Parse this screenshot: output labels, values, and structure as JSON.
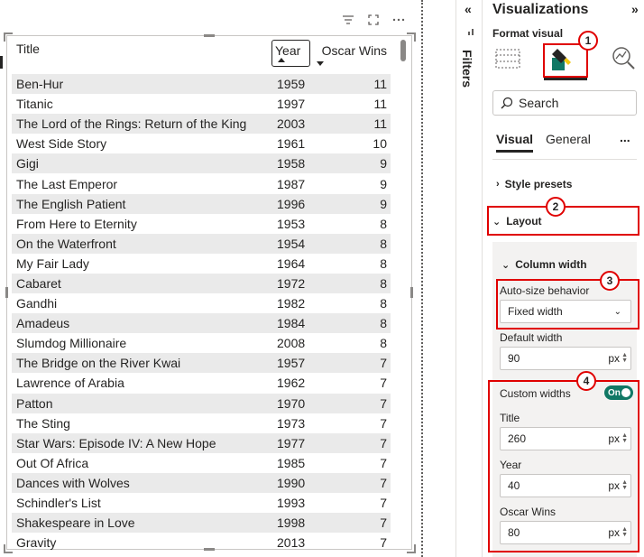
{
  "table": {
    "headers": {
      "title": "Title",
      "year": "Year",
      "wins": "Oscar Wins"
    },
    "rows": [
      {
        "title": "Ben-Hur",
        "year": "1959",
        "wins": "11"
      },
      {
        "title": "Titanic",
        "year": "1997",
        "wins": "11"
      },
      {
        "title": "The Lord of the Rings: Return of the King",
        "year": "2003",
        "wins": "11"
      },
      {
        "title": "West Side Story",
        "year": "1961",
        "wins": "10"
      },
      {
        "title": "Gigi",
        "year": "1958",
        "wins": "9"
      },
      {
        "title": "The Last Emperor",
        "year": "1987",
        "wins": "9"
      },
      {
        "title": "The English Patient",
        "year": "1996",
        "wins": "9"
      },
      {
        "title": "From Here to Eternity",
        "year": "1953",
        "wins": "8"
      },
      {
        "title": "On the Waterfront",
        "year": "1954",
        "wins": "8"
      },
      {
        "title": "My Fair Lady",
        "year": "1964",
        "wins": "8"
      },
      {
        "title": "Cabaret",
        "year": "1972",
        "wins": "8"
      },
      {
        "title": "Gandhi",
        "year": "1982",
        "wins": "8"
      },
      {
        "title": "Amadeus",
        "year": "1984",
        "wins": "8"
      },
      {
        "title": "Slumdog Millionaire",
        "year": "2008",
        "wins": "8"
      },
      {
        "title": "The Bridge on the River Kwai",
        "year": "1957",
        "wins": "7"
      },
      {
        "title": "Lawrence of Arabia",
        "year": "1962",
        "wins": "7"
      },
      {
        "title": "Patton",
        "year": "1970",
        "wins": "7"
      },
      {
        "title": "The Sting",
        "year": "1973",
        "wins": "7"
      },
      {
        "title": "Star Wars: Episode IV: A New Hope",
        "year": "1977",
        "wins": "7"
      },
      {
        "title": "Out Of Africa",
        "year": "1985",
        "wins": "7"
      },
      {
        "title": "Dances with Wolves",
        "year": "1990",
        "wins": "7"
      },
      {
        "title": "Schindler's List",
        "year": "1993",
        "wins": "7"
      },
      {
        "title": "Shakespeare in Love",
        "year": "1998",
        "wins": "7"
      },
      {
        "title": "Gravity",
        "year": "2013",
        "wins": "7"
      }
    ]
  },
  "filters": {
    "label": "Filters",
    "collapse_icon": "double-chevron-left-icon"
  },
  "viz": {
    "title": "Visualizations",
    "expand_icon": "double-chevron-right-icon",
    "format_label": "Format visual",
    "search_placeholder": "Search",
    "tabs": {
      "visual": "Visual",
      "general": "General",
      "more": "..."
    },
    "style_presets": "Style presets",
    "layout": "Layout",
    "column_width": "Column width",
    "auto_size_label": "Auto-size behavior",
    "auto_size_value": "Fixed width",
    "default_width_label": "Default width",
    "default_width_value": "90",
    "custom_widths_label": "Custom widths",
    "toggle_label": "On",
    "title_label": "Title",
    "title_value": "260",
    "year_label": "Year",
    "year_value": "40",
    "wins_label": "Oscar Wins",
    "wins_value": "80",
    "unit": "px"
  },
  "badges": [
    "1",
    "2",
    "3",
    "4"
  ],
  "colors": {
    "highlight": "#e00000",
    "toggle_on": "#117865",
    "row_band": "#eaeaea"
  }
}
